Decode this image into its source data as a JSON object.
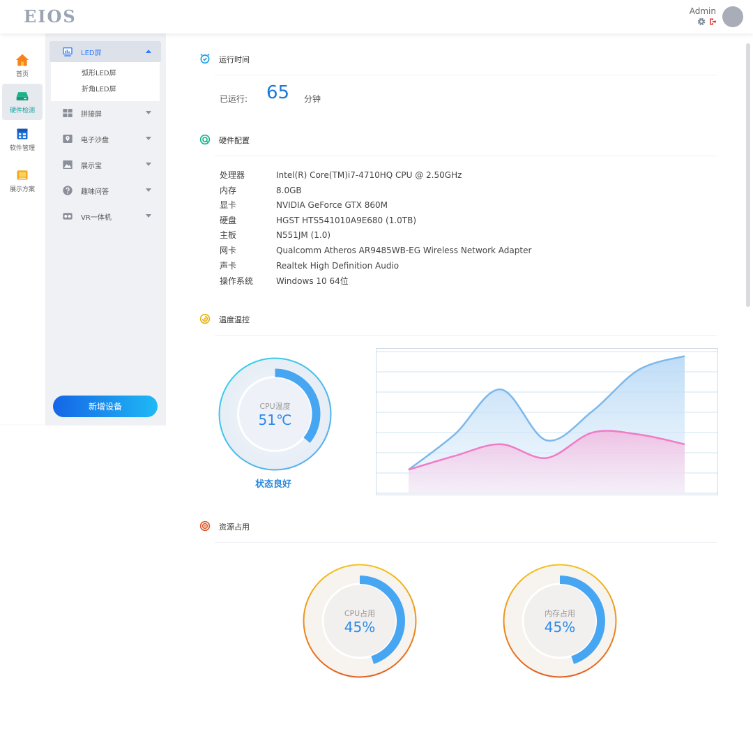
{
  "header": {
    "logo": "EIOS",
    "user": "Admin"
  },
  "leftnav": [
    {
      "label": "首页",
      "icon": "home-icon"
    },
    {
      "label": "硬件检测",
      "icon": "hardware-icon",
      "active": true
    },
    {
      "label": "软件管理",
      "icon": "software-icon"
    },
    {
      "label": "展示方案",
      "icon": "display-plan-icon"
    }
  ],
  "subnav": {
    "expanded": {
      "label": "LED屏",
      "children": [
        "弧形LED屏",
        "折角LED屏"
      ]
    },
    "items": [
      "拼接屏",
      "电子沙盘",
      "展示宝",
      "趣味问答",
      "VR一体机"
    ],
    "add_button": "新增设备"
  },
  "runtime": {
    "title": "运行时间",
    "label": "已运行:",
    "value": "65",
    "unit": "分钟"
  },
  "hardware": {
    "title": "硬件配置",
    "specs": [
      {
        "key": "处理器",
        "value": "Intel(R) Core(TM)i7-4710HQ CPU @ 2.50GHz"
      },
      {
        "key": "内存",
        "value": "8.0GB"
      },
      {
        "key": "显卡",
        "value": "NVIDIA GeForce GTX 860M"
      },
      {
        "key": "硬盘",
        "value": "HGST HTS541010A9E680 (1.0TB)"
      },
      {
        "key": "主板",
        "value": "N551JM (1.0)"
      },
      {
        "key": "网卡",
        "value": "Qualcomm Atheros AR9485WB-EG Wireless Network Adapter"
      },
      {
        "key": "声卡",
        "value": "Realtek High Definition Audio"
      },
      {
        "key": "操作系统",
        "value": "Windows 10 64位"
      }
    ]
  },
  "temperature": {
    "title": "温度温控",
    "gauge": {
      "label": "CPU温度",
      "value": "51℃",
      "fraction": 0.36
    },
    "status": "状态良好"
  },
  "resources": {
    "title": "资源占用",
    "cpu": {
      "label": "CPU占用",
      "value": "45%",
      "fraction": 0.45
    },
    "memory": {
      "label": "内存占用",
      "value": "45%",
      "fraction": 0.45
    }
  },
  "chart_data": {
    "type": "area",
    "x": [
      0,
      1,
      2,
      3,
      4,
      5,
      6
    ],
    "series": [
      {
        "values": [
          1.2,
          3.0,
          5.3,
          2.7,
          4.2,
          6.3,
          7.0
        ],
        "color": "#7bb8ec"
      },
      {
        "values": [
          1.2,
          1.9,
          2.5,
          1.8,
          3.1,
          3.0,
          2.5
        ],
        "color": "#f07bc6"
      }
    ],
    "ylim": [
      0,
      7.3
    ],
    "grid": true
  },
  "colors": {
    "accent": "#2e7bff",
    "teal": "#1aa3a0",
    "button_start": "#1565e6",
    "button_end": "#1fb9f5"
  }
}
